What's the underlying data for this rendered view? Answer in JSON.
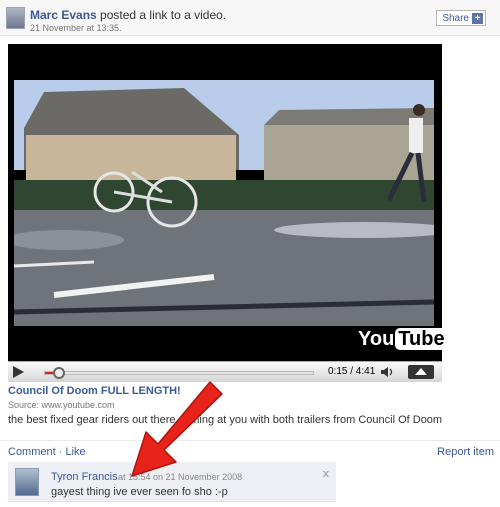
{
  "post": {
    "poster_name": "Marc Evans",
    "action_text": "posted a link to a video.",
    "timestamp": "21 November at 13:35.",
    "share_label": "Share",
    "share_plus": "+"
  },
  "video": {
    "logo_you": "You",
    "logo_tube": "Tube",
    "time": "0:15 / 4:41",
    "progress_fraction": 0.053,
    "title": "Council Of Doom FULL LENGTH!",
    "source": "Source: www.youtube.com",
    "description": "the best fixed gear riders out there coming at you with both trailers from Council Of Doom"
  },
  "actions": {
    "comment": "Comment",
    "separator": "·",
    "like": "Like",
    "report": "Report item"
  },
  "comment": {
    "author": "Tyron Francis",
    "meta": "at 15:54 on 21 November 2008",
    "text": "gayest thing ive ever seen fo sho :-p",
    "close": "x"
  },
  "colors": {
    "link": "#3b5998",
    "arrow": "#e8231c",
    "progress": "#dd2222"
  },
  "icons": [
    "play-icon",
    "volume-icon",
    "expand-icon",
    "share-plus-icon",
    "close-icon",
    "red-arrow-annotation"
  ]
}
